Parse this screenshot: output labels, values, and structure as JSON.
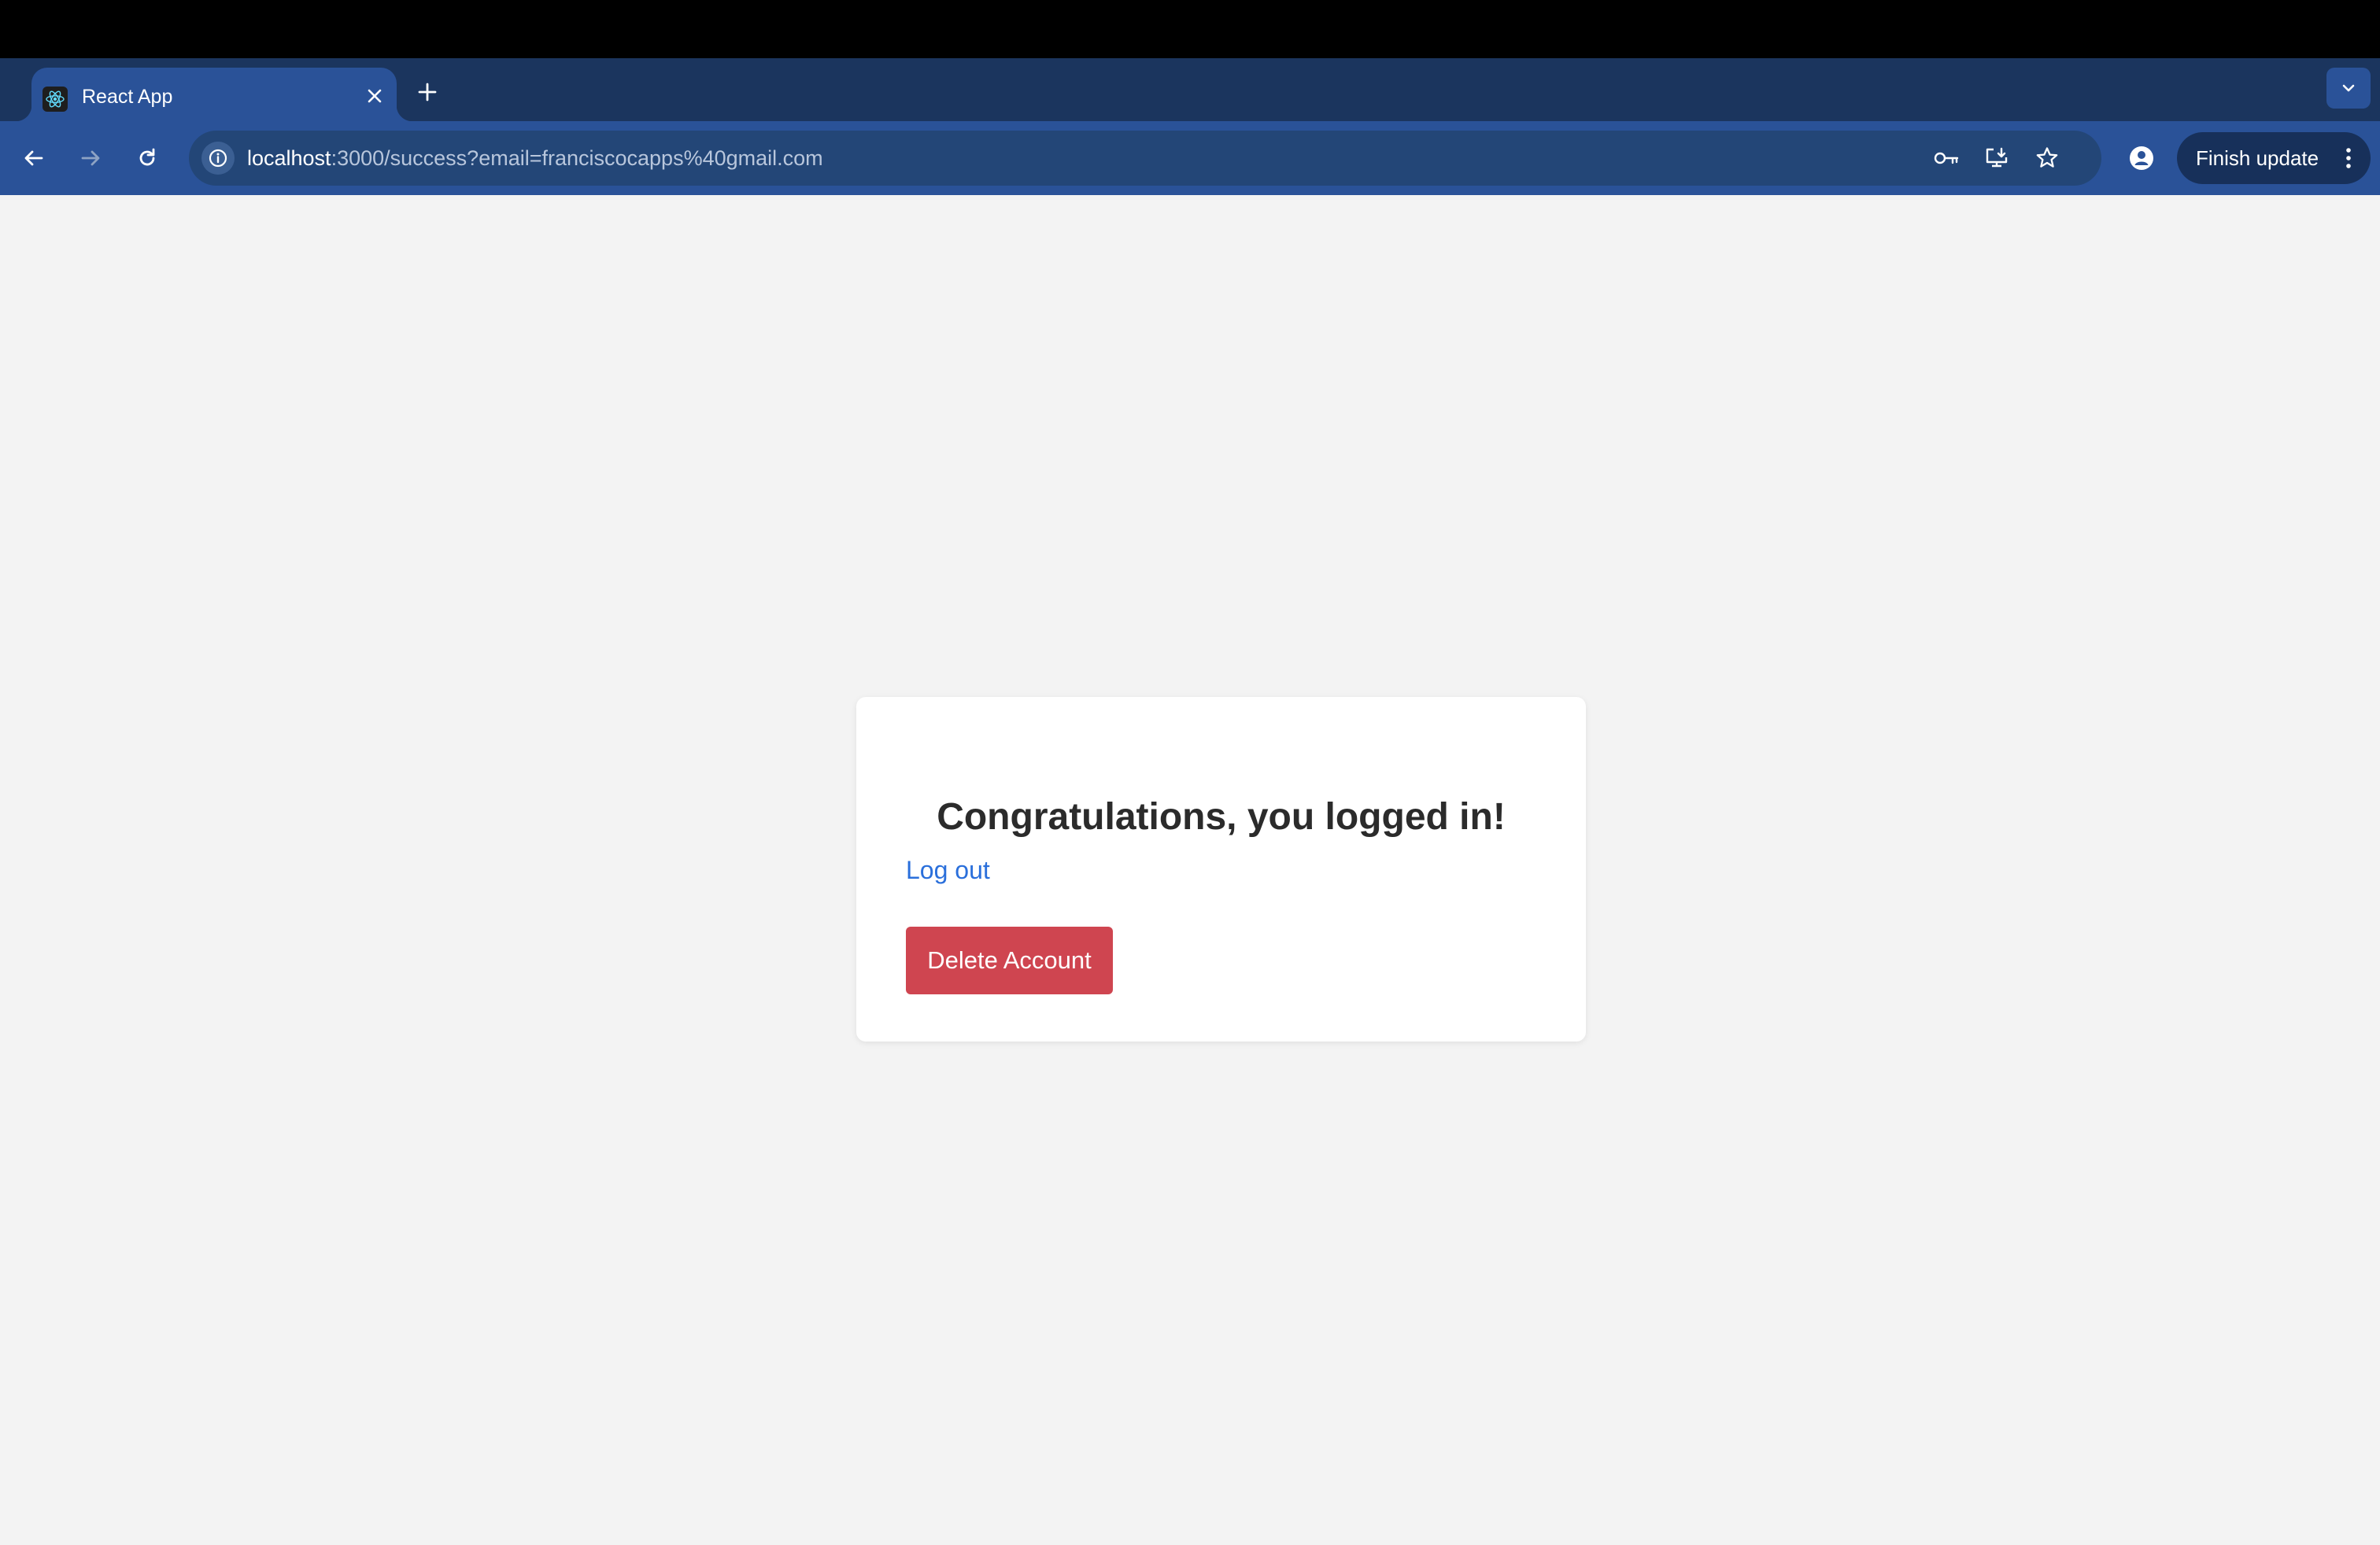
{
  "browser": {
    "tab": {
      "title": "React App"
    },
    "url": {
      "host": "localhost",
      "rest": ":3000/success?email=franciscocapps%40gmail.com"
    },
    "update_button": {
      "label": "Finish update"
    }
  },
  "page": {
    "heading": "Congratulations, you logged in!",
    "logout_link": "Log out",
    "delete_button": "Delete Account"
  },
  "colors": {
    "toolbar": "#2a5298",
    "tabstrip": "#1b355e",
    "page_background": "#f3f3f3",
    "link": "#2a6fdb",
    "danger_button": "#cf4550"
  }
}
